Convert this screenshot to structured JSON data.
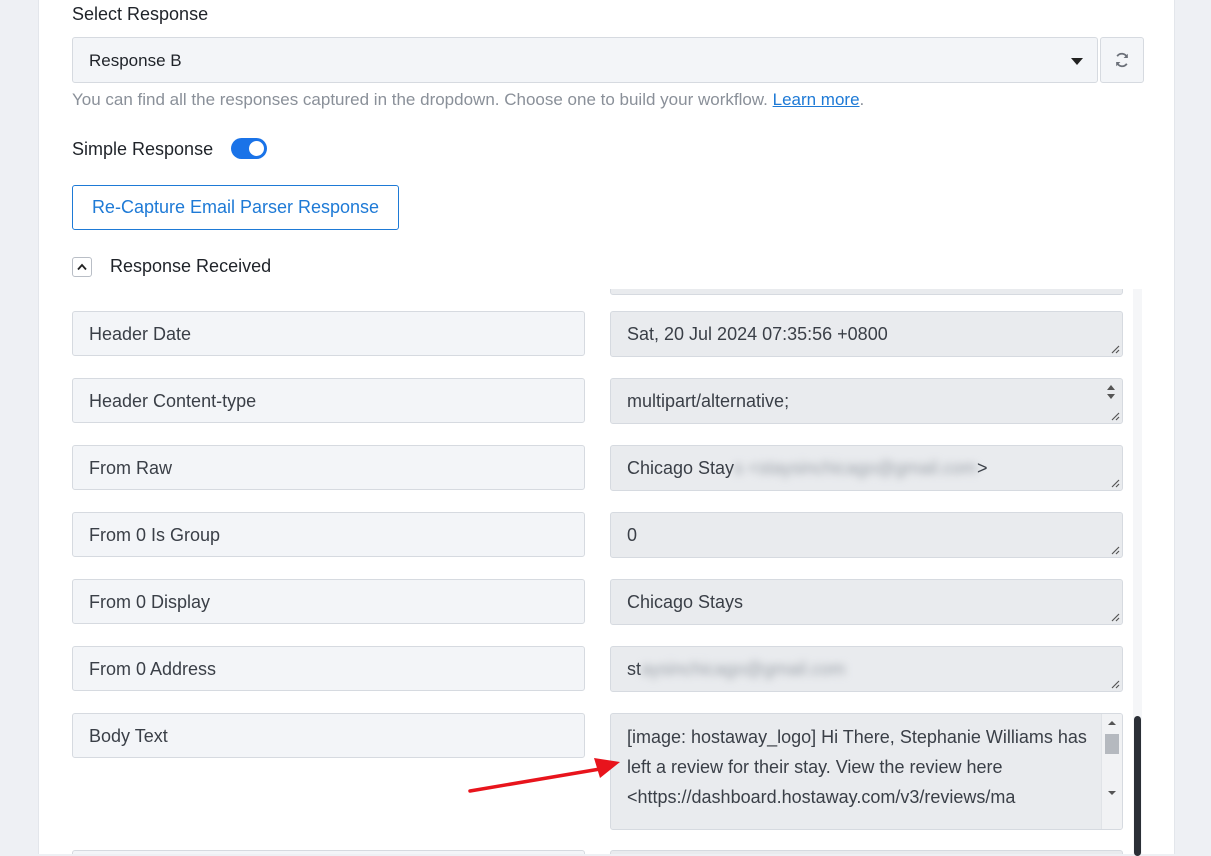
{
  "select_response": {
    "label": "Select Response",
    "selected": "Response B",
    "help_text": "You can find all the responses captured in the dropdown. Choose one to build your workflow.",
    "help_link": "Learn more",
    "help_suffix": "."
  },
  "simple_response": {
    "label": "Simple Response",
    "enabled": true
  },
  "recapture_button": "Re-Capture Email Parser Response",
  "response_received": {
    "label": "Response Received",
    "rows": [
      {
        "key": "Header Date",
        "value": "Sat, 20 Jul 2024 07:35:56 +0800"
      },
      {
        "key": "Header Content-type",
        "value": "multipart/alternative;"
      },
      {
        "key": "From Raw",
        "value": "Chicago Stay",
        "value_blurred": "s <staysinchicago@gmail.com",
        "value_suffix": ">"
      },
      {
        "key": "From 0 Is Group",
        "value": "0"
      },
      {
        "key": "From 0 Display",
        "value": "Chicago Stays"
      },
      {
        "key": "From 0 Address",
        "value": "st",
        "value_blurred": "aysinchicago@gmail.com"
      },
      {
        "key": "Body Text",
        "value": "[image: hostaway_logo] Hi There, Stephanie Williams has left a review for their stay. View the review here <https://dashboard.hostaway.com/v3/reviews/ma"
      }
    ]
  },
  "colors": {
    "accent": "#1e7ad6",
    "toggle": "#1a73e8",
    "arrow": "#e8141c"
  }
}
